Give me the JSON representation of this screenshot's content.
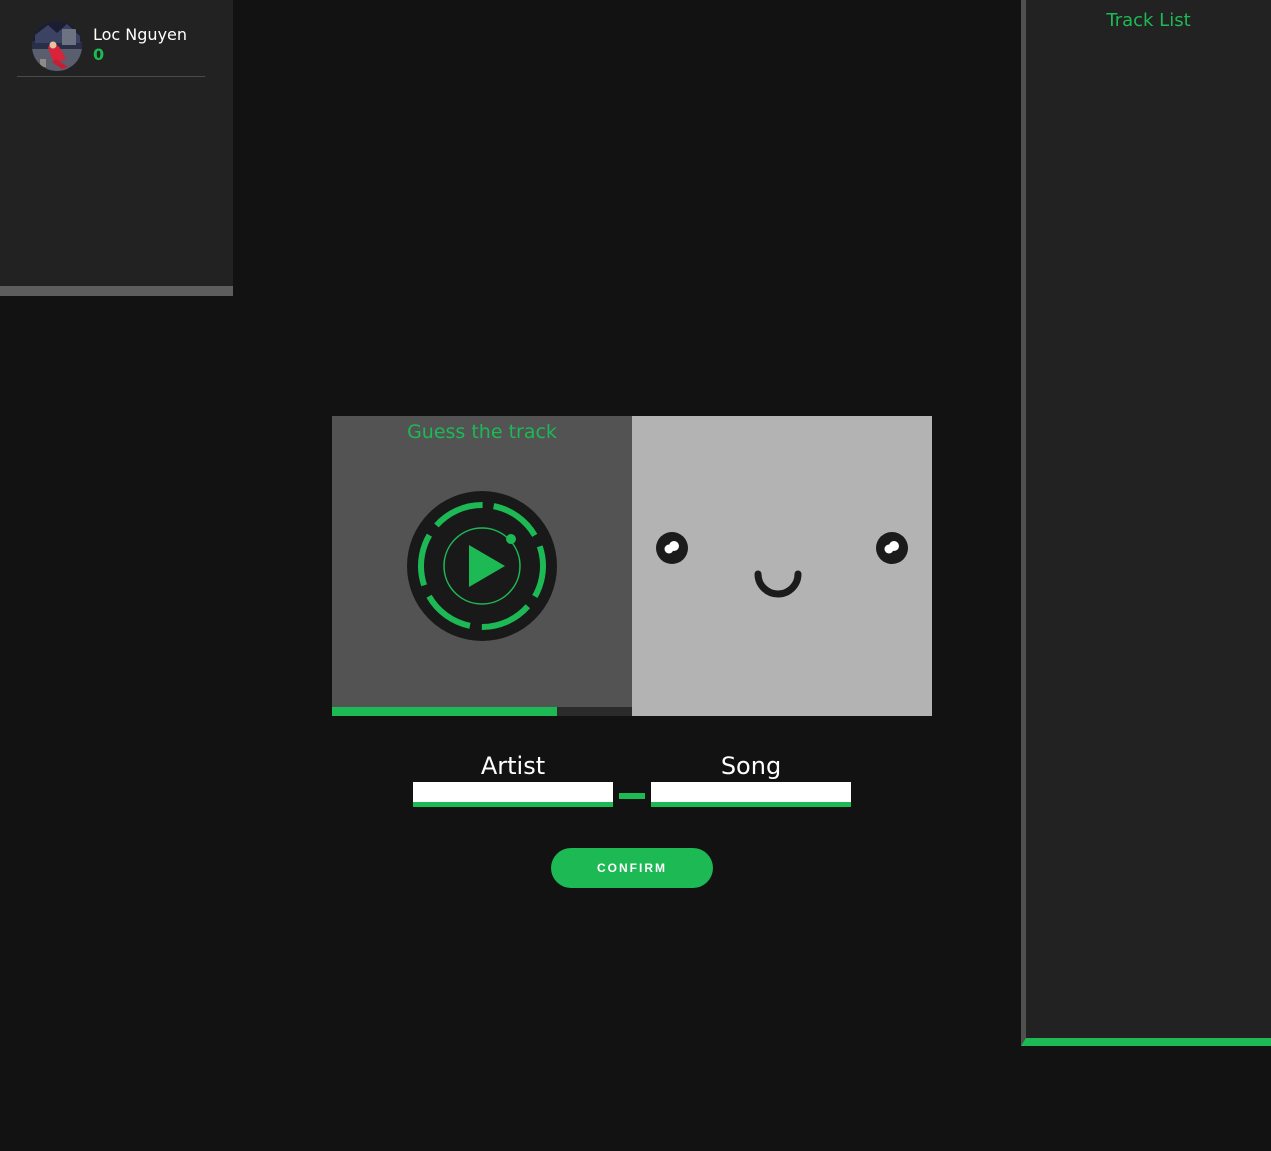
{
  "players": [
    {
      "name": "Loc Nguyen",
      "score": "0",
      "avatar": "player-avatar-photo"
    }
  ],
  "tracklist": {
    "title": "Track List",
    "items": []
  },
  "game": {
    "title": "Guess the track",
    "play_icon": "play-icon",
    "progress_fraction": 0.75
  },
  "face": {
    "eyes_icon": "eye-icon",
    "mouth_icon": "smile-icon"
  },
  "answer": {
    "artist_label": "Artist",
    "artist_value": "",
    "song_label": "Song",
    "song_value": "",
    "separator": "-"
  },
  "confirm_label": "CONFIRM",
  "colors": {
    "accent": "#1db954",
    "background": "#121212",
    "panel": "#222222",
    "player_half": "#535353",
    "face_half": "#b3b3b3"
  }
}
